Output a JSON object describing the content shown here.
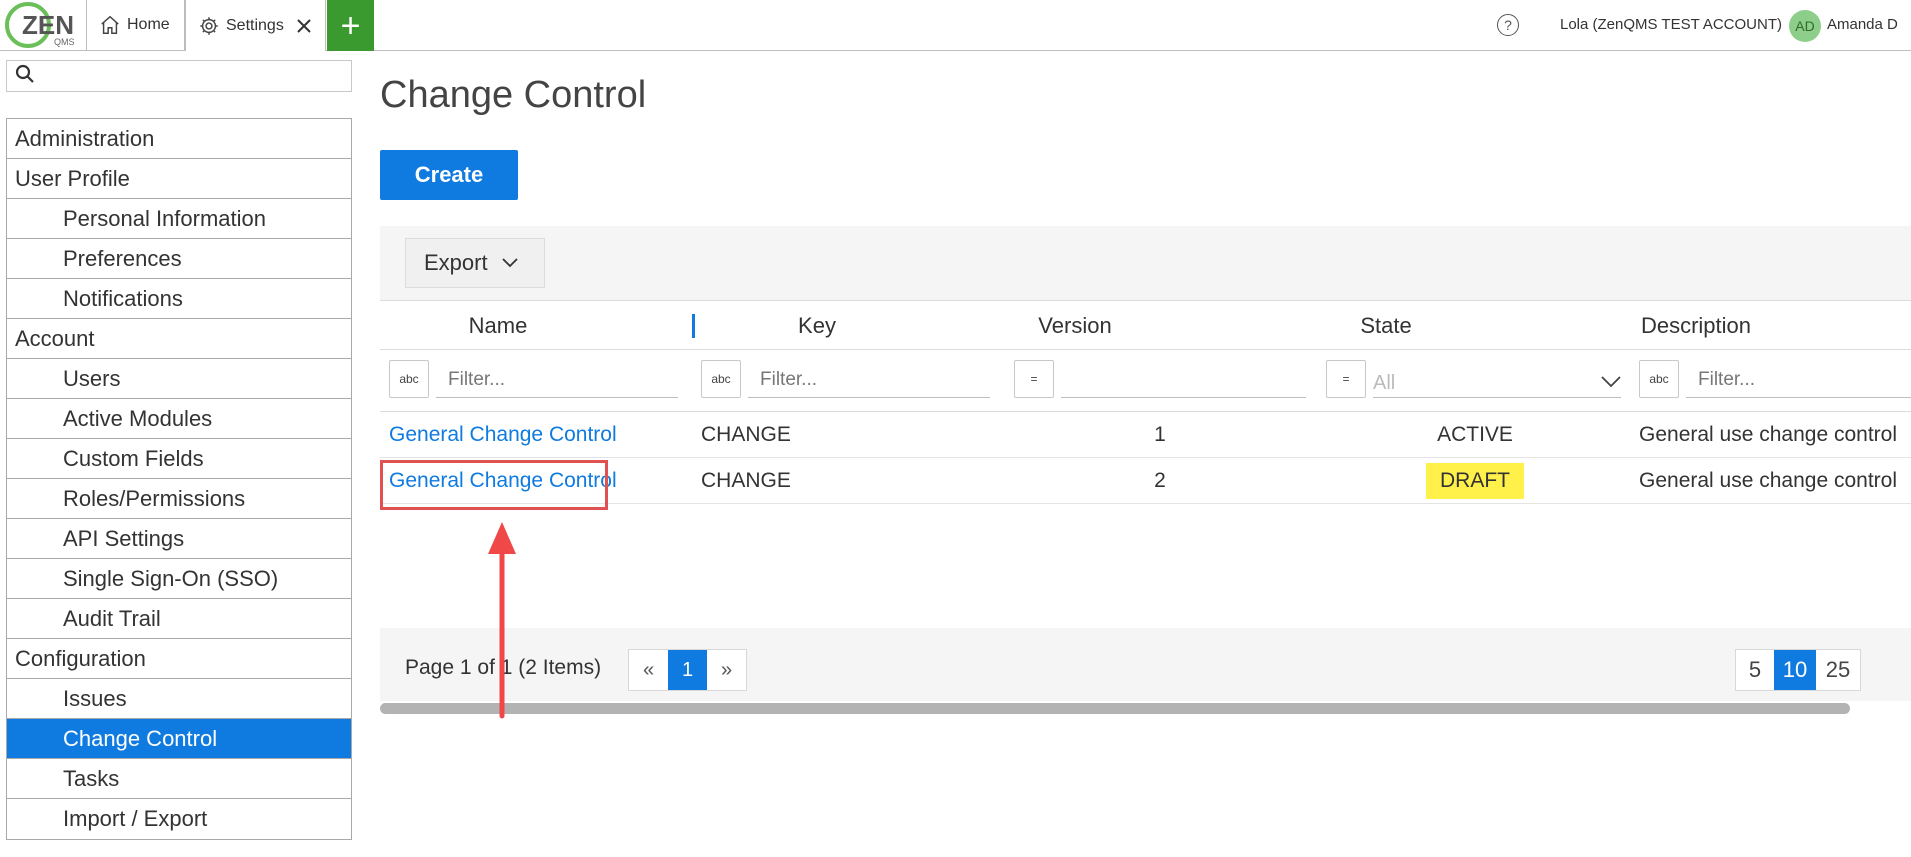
{
  "topbar": {
    "logo_text": "ZEN",
    "logo_sub": "QMS",
    "tabs": [
      {
        "label": "Home",
        "icon": "home-icon"
      },
      {
        "label": "Settings",
        "icon": "gear-icon"
      }
    ],
    "add_tab": "+",
    "help": "?",
    "account": "Lola (ZenQMS TEST ACCOUNT)",
    "avatar_initials": "AD",
    "username": "Amanda D"
  },
  "sidebar": {
    "search_placeholder": "",
    "items": [
      {
        "label": "Administration",
        "level": "section"
      },
      {
        "label": "User Profile",
        "level": "section"
      },
      {
        "label": "Personal Information",
        "level": "sub"
      },
      {
        "label": "Preferences",
        "level": "sub"
      },
      {
        "label": "Notifications",
        "level": "sub"
      },
      {
        "label": "Account",
        "level": "section"
      },
      {
        "label": "Users",
        "level": "sub"
      },
      {
        "label": "Active Modules",
        "level": "sub"
      },
      {
        "label": "Custom Fields",
        "level": "sub"
      },
      {
        "label": "Roles/Permissions",
        "level": "sub"
      },
      {
        "label": "API Settings",
        "level": "sub"
      },
      {
        "label": "Single Sign-On (SSO)",
        "level": "sub"
      },
      {
        "label": "Audit Trail",
        "level": "sub"
      },
      {
        "label": "Configuration",
        "level": "section"
      },
      {
        "label": "Issues",
        "level": "sub"
      },
      {
        "label": "Change Control",
        "level": "sub",
        "active": true
      },
      {
        "label": "Tasks",
        "level": "sub"
      },
      {
        "label": "Import / Export",
        "level": "sub"
      }
    ]
  },
  "main": {
    "title": "Change Control",
    "create_label": "Create",
    "export_label": "Export",
    "columns": [
      "Name",
      "Key",
      "Version",
      "State",
      "Description"
    ],
    "filters": {
      "name_placeholder": "Filter...",
      "key_placeholder": "Filter...",
      "version_value": "",
      "state_value": "All",
      "description_placeholder": "Filter...",
      "text_filter_icon": "abc",
      "eq_filter_icon": "="
    },
    "rows": [
      {
        "name": "General Change Control",
        "key": "CHANGE",
        "version": "1",
        "state": "ACTIVE",
        "description": "General use change control"
      },
      {
        "name": "General Change Control",
        "key": "CHANGE",
        "version": "2",
        "state": "DRAFT",
        "description": "General use change control"
      }
    ],
    "pager": {
      "summary": "Page 1 of 1 (2 Items)",
      "prev": "«",
      "current": "1",
      "next": "»",
      "sizes": [
        "5",
        "10",
        "25"
      ],
      "selected_size": "10"
    }
  },
  "colors": {
    "accent": "#0f7be0",
    "add_tab": "#3b9a2f",
    "draft_highlight": "#fff04a",
    "annotation": "#e05252"
  }
}
